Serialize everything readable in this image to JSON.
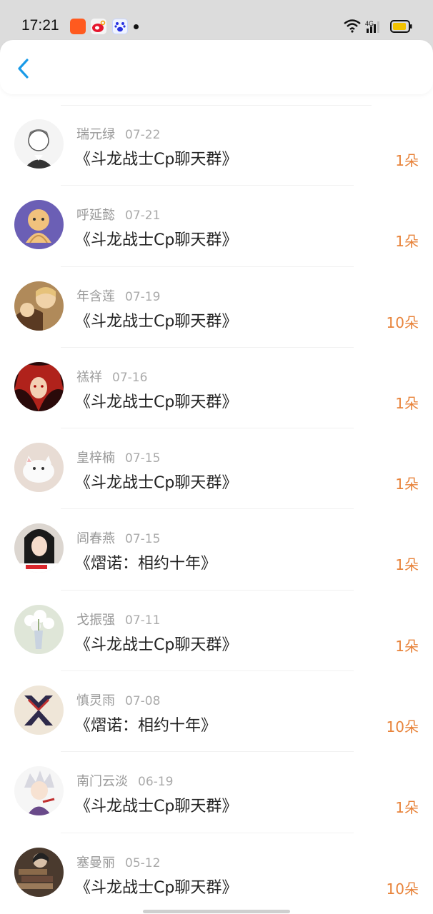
{
  "status_bar": {
    "time": "17:21",
    "icons": [
      "kuaishou-icon",
      "weibo-icon",
      "baidu-icon",
      "notification-dot",
      "wifi-icon",
      "4g-signal-icon",
      "battery-icon"
    ],
    "battery_color": "#f2c200"
  },
  "header": {
    "back_icon": "chevron-left-icon",
    "accent_color": "#1a9be8"
  },
  "colors": {
    "amount": "#e8833a",
    "name": "#999999",
    "title": "#222222"
  },
  "items": [
    {
      "name": "瑞元绿",
      "date": "07-22",
      "title": "《斗龙战士Cp聊天群》",
      "amount": "1朵",
      "avatar": "anime-boy-sketch"
    },
    {
      "name": "呼延懿",
      "date": "07-21",
      "title": "《斗龙战士Cp聊天群》",
      "amount": "1朵",
      "avatar": "purple-cartoon"
    },
    {
      "name": "年含莲",
      "date": "07-19",
      "title": "《斗龙战士Cp聊天群》",
      "amount": "10朵",
      "avatar": "anime-hug"
    },
    {
      "name": "禚祥",
      "date": "07-16",
      "title": "《斗龙战士Cp聊天群》",
      "amount": "1朵",
      "avatar": "anime-red-hair"
    },
    {
      "name": "皇梓楠",
      "date": "07-15",
      "title": "《斗龙战士Cp聊天群》",
      "amount": "1朵",
      "avatar": "white-kitten"
    },
    {
      "name": "闾春燕",
      "date": "07-15",
      "title": "《熠诺：相约十年》",
      "amount": "1朵",
      "avatar": "girl-portrait"
    },
    {
      "name": "戈振强",
      "date": "07-11",
      "title": "《斗龙战士Cp聊天群》",
      "amount": "1朵",
      "avatar": "flower-vase"
    },
    {
      "name": "慎灵雨",
      "date": "07-08",
      "title": "《熠诺：相约十年》",
      "amount": "10朵",
      "avatar": "x-emblem"
    },
    {
      "name": "南门云淡",
      "date": "06-19",
      "title": "《斗龙战士Cp聊天群》",
      "amount": "1朵",
      "avatar": "anime-silver-hair"
    },
    {
      "name": "塞曼丽",
      "date": "05-12",
      "title": "《斗龙战士Cp聊天群》",
      "amount": "10朵",
      "avatar": "books-photo"
    }
  ]
}
